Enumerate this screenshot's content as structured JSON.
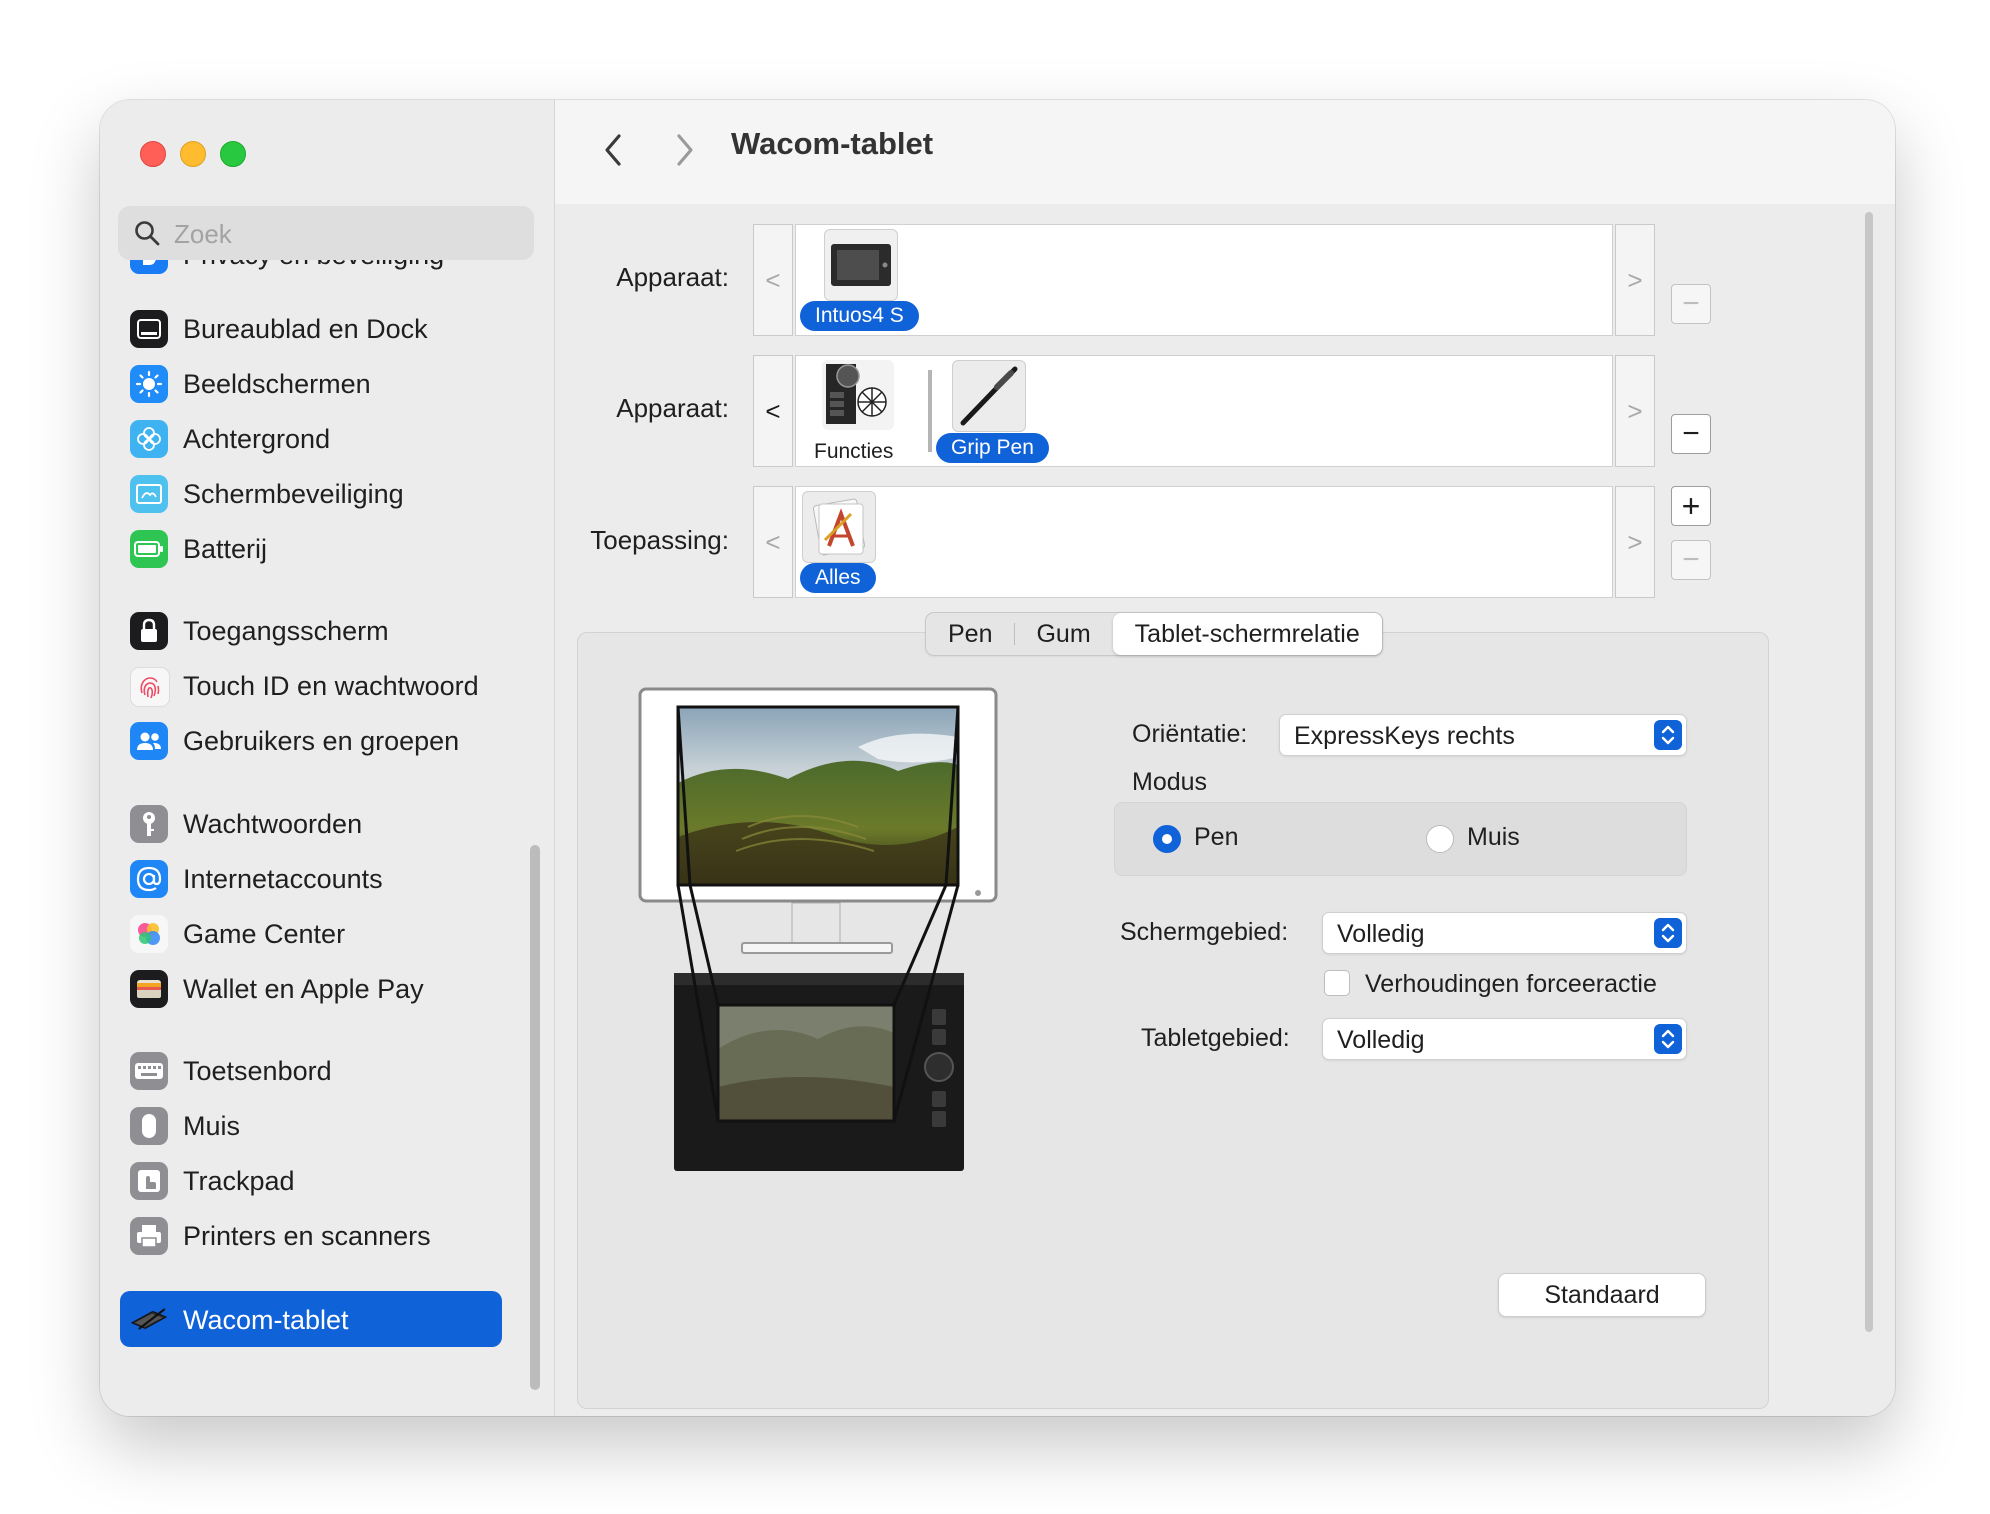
{
  "window": {
    "title": "Wacom-tablet"
  },
  "sidebar": {
    "search_placeholder": "Zoek",
    "items": [
      {
        "label": "Privacy en beveiliging",
        "icon": "hand-icon",
        "color": "#1a7cf5"
      },
      {
        "label": "Bureaublad en Dock",
        "icon": "dock-icon",
        "color": "#1c1c1e"
      },
      {
        "label": "Beeldschermen",
        "icon": "sun-icon",
        "color": "#1f8cf8"
      },
      {
        "label": "Achtergrond",
        "icon": "flower-icon",
        "color": "#3fb3f2"
      },
      {
        "label": "Schermbeveiliging",
        "icon": "screensaver-icon",
        "color": "#4ec1ef"
      },
      {
        "label": "Batterij",
        "icon": "battery-icon",
        "color": "#2fc552"
      },
      {
        "label": "Toegangsscherm",
        "icon": "lock-icon",
        "color": "#1c1c1e"
      },
      {
        "label": "Touch ID en wachtwoord",
        "icon": "fingerprint-icon",
        "color": "#f2f2f2"
      },
      {
        "label": "Gebruikers en groepen",
        "icon": "users-icon",
        "color": "#1f86f5"
      },
      {
        "label": "Wachtwoorden",
        "icon": "key-icon",
        "color": "#8e8e93"
      },
      {
        "label": "Internetaccounts",
        "icon": "at-icon",
        "color": "#1f86f5"
      },
      {
        "label": "Game Center",
        "icon": "game-center-icon",
        "color": "#f2f2f2"
      },
      {
        "label": "Wallet en Apple Pay",
        "icon": "wallet-icon",
        "color": "#1c1c1e"
      },
      {
        "label": "Toetsenbord",
        "icon": "keyboard-icon",
        "color": "#8e8e93"
      },
      {
        "label": "Muis",
        "icon": "mouse-icon",
        "color": "#8e8e93"
      },
      {
        "label": "Trackpad",
        "icon": "trackpad-icon",
        "color": "#8e8e93"
      },
      {
        "label": "Printers en scanners",
        "icon": "printer-icon",
        "color": "#8e8e93"
      },
      {
        "label": "Wacom-tablet",
        "icon": "wacom-tablet-icon",
        "color": "#1062d8",
        "selected": true
      }
    ]
  },
  "devices": {
    "row1": {
      "label": "Apparaat:",
      "prev": "<",
      "next": ">",
      "item": "Intuos4 S",
      "remove": "−"
    },
    "row2": {
      "label": "Apparaat:",
      "prev": "<",
      "next": ">",
      "items": [
        "Functies",
        "Grip Pen"
      ],
      "remove": "−"
    },
    "row3": {
      "label": "Toepassing:",
      "prev": "<",
      "next": ">",
      "item": "Alles",
      "add": "+",
      "remove": "−"
    }
  },
  "tabs": [
    "Pen",
    "Gum",
    "Tablet-schermrelatie"
  ],
  "selected_tab": "Tablet-schermrelatie",
  "settings": {
    "orientation_label": "Oriëntatie:",
    "orientation_value": "ExpressKeys rechts",
    "mode_label": "Modus",
    "mode_options": [
      "Pen",
      "Muis"
    ],
    "mode_selected": "Pen",
    "screen_area_label": "Schermgebied:",
    "screen_area_value": "Volledig",
    "force_proportions_label": "Verhoudingen forceeractie",
    "force_proportions_checked": false,
    "tablet_area_label": "Tabletgebied:",
    "tablet_area_value": "Volledig"
  },
  "buttons": {
    "default": "Standaard"
  },
  "accent_color": "#1062d8"
}
